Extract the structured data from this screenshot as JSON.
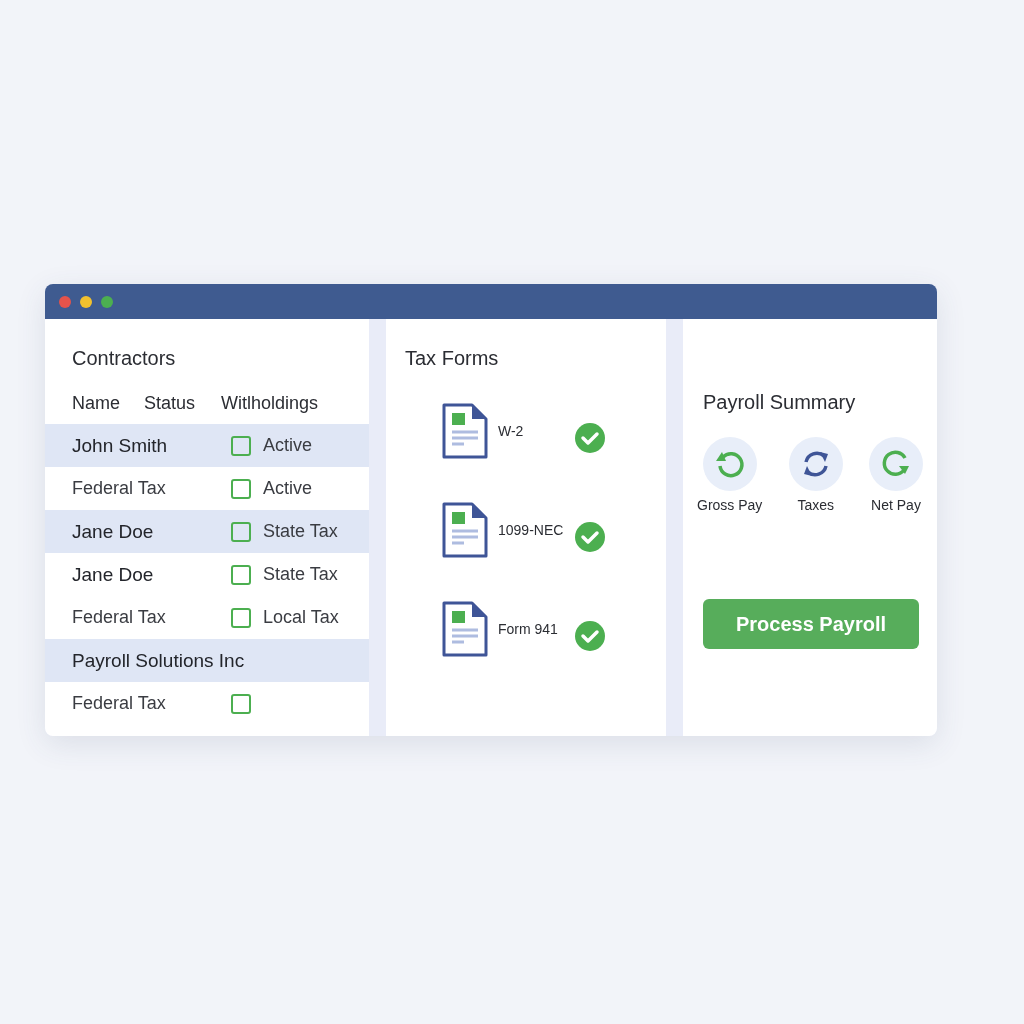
{
  "window": {
    "controls": [
      {
        "color": "#e5534b"
      },
      {
        "color": "#f2c12e"
      },
      {
        "color": "#4caf50"
      }
    ]
  },
  "contractors": {
    "title": "Contractors",
    "columns": [
      "Name",
      "Status",
      "Witlholdings"
    ],
    "rows": [
      {
        "kind": "contractor",
        "name": "John Smith",
        "checked": false,
        "status": "Active",
        "shaded": true
      },
      {
        "kind": "tax",
        "name": "Federal Tax",
        "checked": false,
        "status": "Active",
        "shaded": false
      },
      {
        "kind": "contractor",
        "name": "Jane Doe",
        "checked": false,
        "status": "State Tax",
        "shaded": true
      },
      {
        "kind": "contractor",
        "name": "Jane Doe",
        "checked": false,
        "status": "State Tax",
        "shaded": false
      },
      {
        "kind": "tax",
        "name": "Federal Tax",
        "checked": false,
        "status": "Local Tax",
        "shaded": false
      },
      {
        "kind": "contractor",
        "name": "Payroll Solutions Inc",
        "shaded": true
      },
      {
        "kind": "tax",
        "name": "Federal Tax",
        "checked": false,
        "shaded": false
      }
    ]
  },
  "tax_forms": {
    "title": "Tax Forms",
    "items": [
      {
        "label": "W-2",
        "done": true
      },
      {
        "label": "1099-NEC",
        "done": true
      },
      {
        "label": "Form 941",
        "done": true
      }
    ]
  },
  "payroll_summary": {
    "title": "Payroll Summary",
    "items": [
      {
        "kind": "ccw",
        "label": "Gross Pay",
        "color": "#4caf50"
      },
      {
        "kind": "sync",
        "label": "Taxes",
        "color": "#3f5597"
      },
      {
        "kind": "cw",
        "label": "Net Pay",
        "color": "#4caf50"
      }
    ],
    "button": "Process Payroll"
  }
}
